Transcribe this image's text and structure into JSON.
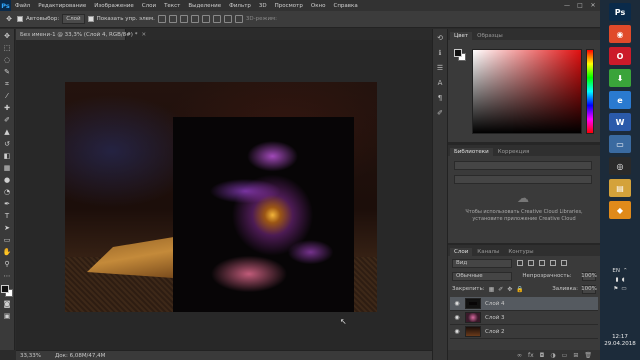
{
  "menubar": {
    "logo": "Ps",
    "items": [
      "Файл",
      "Редактирование",
      "Изображение",
      "Слои",
      "Текст",
      "Выделение",
      "Фильтр",
      "3D",
      "Просмотр",
      "Окно",
      "Справка"
    ],
    "window_controls": [
      "—",
      "□",
      "✕"
    ]
  },
  "options": {
    "autoselect_label": "Автовыбор:",
    "autoselect_value": "Слой",
    "show_controls_label": "Показать упр. элем.",
    "mode_3d": "3D-режим:"
  },
  "document": {
    "tab_title": "Без имени-1 @ 33,3% (Слой 4, RGB/8#) *",
    "close": "✕"
  },
  "status": {
    "zoom": "33,33%",
    "doc_size": "Док: 6,08M/47,4M"
  },
  "color_panel": {
    "tabs": [
      "Цвет",
      "Образцы"
    ]
  },
  "libraries_panel": {
    "tabs": [
      "Библиотеки",
      "Коррекция"
    ],
    "message": "Чтобы использовать Creative Cloud Libraries, установите приложение Creative Cloud"
  },
  "layers_panel": {
    "tabs": [
      "Слои",
      "Каналы",
      "Контуры"
    ],
    "kind": "Вид",
    "blend_mode": "Обычные",
    "opacity_label": "Непрозрачность:",
    "opacity_value": "100%",
    "lock_label": "Закрепить:",
    "fill_label": "Заливка:",
    "fill_value": "100%",
    "layers": [
      {
        "name": "Слой 4",
        "selected": true
      },
      {
        "name": "Слой 3",
        "selected": false
      },
      {
        "name": "Слой 2",
        "selected": false
      }
    ]
  },
  "taskbar": {
    "apps": [
      {
        "icon": "ps-icon",
        "glyph": "Ps",
        "color": "#0a2a4a"
      },
      {
        "icon": "chrome-icon",
        "glyph": "◉",
        "color": "#e04a2a"
      },
      {
        "icon": "opera-icon",
        "glyph": "O",
        "color": "#cc1b2a"
      },
      {
        "icon": "installer-icon",
        "glyph": "⬇",
        "color": "#3aa43a"
      },
      {
        "icon": "ie-icon",
        "glyph": "e",
        "color": "#2a7ad0"
      },
      {
        "icon": "word-icon",
        "glyph": "W",
        "color": "#2b5aaa"
      },
      {
        "icon": "monitor-icon",
        "glyph": "▭",
        "color": "#3a6aa0"
      },
      {
        "icon": "app-icon",
        "glyph": "◎",
        "color": "#2a2a2a"
      },
      {
        "icon": "folder-icon",
        "glyph": "▤",
        "color": "#d4a23a"
      },
      {
        "icon": "shield-icon",
        "glyph": "◆",
        "color": "#e08a1a"
      }
    ],
    "lang": "EN",
    "time": "12:17",
    "date": "29.04.2018"
  }
}
